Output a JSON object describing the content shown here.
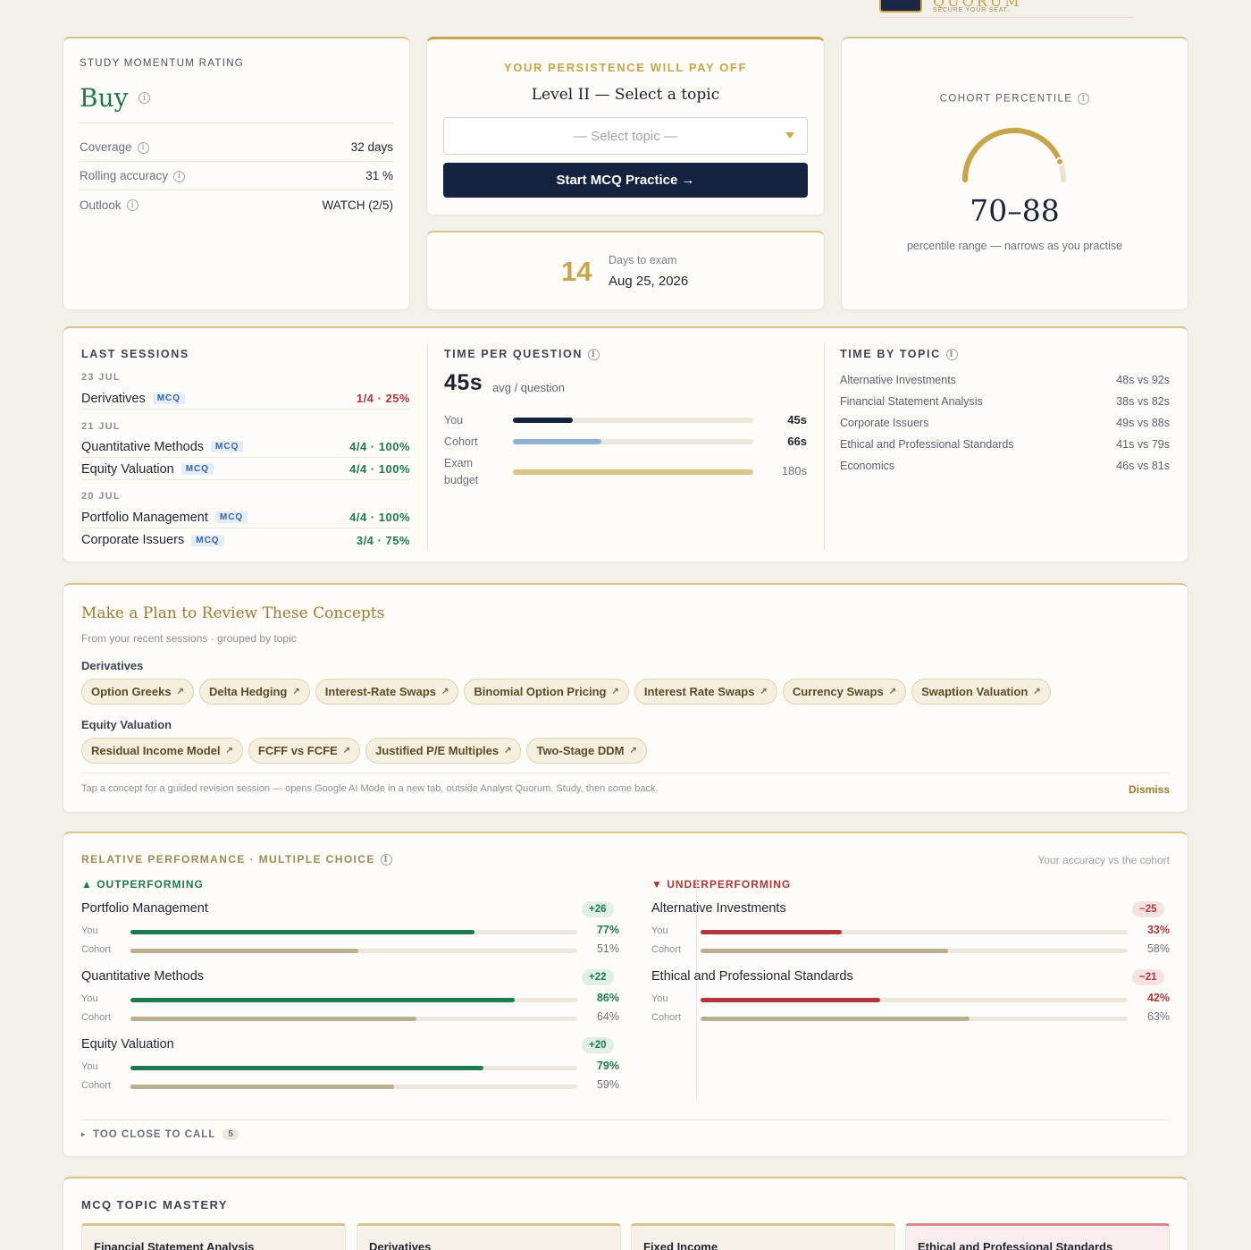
{
  "brand": {
    "name": "QUORUM",
    "tagline": "SECURE YOUR SEAT."
  },
  "momentum": {
    "label": "Study Momentum Rating",
    "rating": "Buy",
    "rows": [
      {
        "label": "Coverage",
        "value": "32 days"
      },
      {
        "label": "Rolling accuracy",
        "value": "31 %"
      },
      {
        "label": "Outlook",
        "value": "WATCH (2/5)"
      }
    ]
  },
  "practice": {
    "headline": "Your persistence will pay off",
    "title": "Level II — Select a topic",
    "select_placeholder": "— Select topic —",
    "start_label": "Start MCQ Practice →"
  },
  "exam": {
    "days": "14",
    "label": "Days to exam",
    "date": "Aug 25, 2026"
  },
  "percentile": {
    "label": "Cohort Percentile",
    "range": "70–88",
    "subtitle": "percentile range — narrows as you practise",
    "low": 70,
    "high": 88
  },
  "sessions": {
    "title": "Last Sessions",
    "groups": [
      {
        "date": "23 Jul",
        "items": [
          {
            "topic": "Derivatives",
            "tag": "MCQ",
            "score": "1/4 · 25%",
            "status": "bad"
          }
        ]
      },
      {
        "date": "21 Jul",
        "items": [
          {
            "topic": "Quantitative Methods",
            "tag": "MCQ",
            "score": "4/4 · 100%",
            "status": "good"
          },
          {
            "topic": "Equity Valuation",
            "tag": "MCQ",
            "score": "4/4 · 100%",
            "status": "good"
          }
        ]
      },
      {
        "date": "20 Jul",
        "items": [
          {
            "topic": "Portfolio Management",
            "tag": "MCQ",
            "score": "4/4 · 100%",
            "status": "good"
          },
          {
            "topic": "Corporate Issuers",
            "tag": "MCQ",
            "score": "3/4 · 75%",
            "status": "good"
          }
        ]
      }
    ]
  },
  "time_per_question": {
    "title": "Time per question",
    "avg": "45s",
    "avg_label": "avg / question",
    "bars": [
      {
        "label": "You",
        "value": "45s",
        "seconds": 45,
        "color": "#152340"
      },
      {
        "label": "Cohort",
        "value": "66s",
        "seconds": 66,
        "color": "#8fb0d6"
      },
      {
        "label": "Exam budget",
        "value": "180s",
        "seconds": 180,
        "color": "#dcc488"
      }
    ],
    "max_seconds": 180
  },
  "time_by_topic": {
    "title": "Time by topic",
    "rows": [
      {
        "topic": "Alternative Investments",
        "value": "48s vs 92s"
      },
      {
        "topic": "Financial Statement Analysis",
        "value": "38s vs 82s"
      },
      {
        "topic": "Corporate Issuers",
        "value": "49s vs 88s"
      },
      {
        "topic": "Ethical and Professional Standards",
        "value": "41s vs 79s"
      },
      {
        "topic": "Economics",
        "value": "46s vs 81s"
      }
    ]
  },
  "plan": {
    "title": "Make a Plan to Review These Concepts",
    "subtitle": "From your recent sessions · grouped by topic",
    "groups": [
      {
        "topic": "Derivatives",
        "concepts": [
          "Option Greeks",
          "Delta Hedging",
          "Interest-Rate Swaps",
          "Binomial Option Pricing",
          "Interest Rate Swaps",
          "Currency Swaps",
          "Swaption Valuation"
        ]
      },
      {
        "topic": "Equity Valuation",
        "concepts": [
          "Residual Income Model",
          "FCFF vs FCFE",
          "Justified P/E Multiples",
          "Two-Stage DDM"
        ]
      }
    ],
    "footnote": "Tap a concept for a guided revision session — opens Google AI Mode in a new tab, outside Analyst Quorum. Study, then come back.",
    "dismiss": "Dismiss"
  },
  "relative": {
    "title": "Relative Performance · Multiple Choice",
    "note": "Your accuracy vs the cohort",
    "you_label": "You",
    "cohort_label": "Cohort",
    "out_title": "▲ Outperforming",
    "under_title": "▼ Underperforming",
    "outperforming": [
      {
        "topic": "Portfolio Management",
        "delta": "+26",
        "you": 77,
        "cohort": 51,
        "you_text": "77%",
        "cohort_text": "51%"
      },
      {
        "topic": "Quantitative Methods",
        "delta": "+22",
        "you": 86,
        "cohort": 64,
        "you_text": "86%",
        "cohort_text": "64%"
      },
      {
        "topic": "Equity Valuation",
        "delta": "+20",
        "you": 79,
        "cohort": 59,
        "you_text": "79%",
        "cohort_text": "59%"
      }
    ],
    "underperforming": [
      {
        "topic": "Alternative Investments",
        "delta": "−25",
        "you": 33,
        "cohort": 58,
        "you_text": "33%",
        "cohort_text": "58%"
      },
      {
        "topic": "Ethical and Professional Standards",
        "delta": "−21",
        "you": 42,
        "cohort": 63,
        "you_text": "42%",
        "cohort_text": "63%"
      }
    ],
    "too_close_label": "Too close to call",
    "too_close_count": "5",
    "colors": {
      "good": "#1f7a4f",
      "bad": "#b0363a",
      "cohort": "#bcae90"
    }
  },
  "mastery": {
    "title": "MCQ Topic Mastery",
    "cards": [
      {
        "topic": "Financial Statement Analysis",
        "alert": false
      },
      {
        "topic": "Derivatives",
        "alert": false
      },
      {
        "topic": "Fixed Income",
        "alert": false
      },
      {
        "topic": "Ethical and Professional Standards",
        "alert": true
      }
    ]
  }
}
